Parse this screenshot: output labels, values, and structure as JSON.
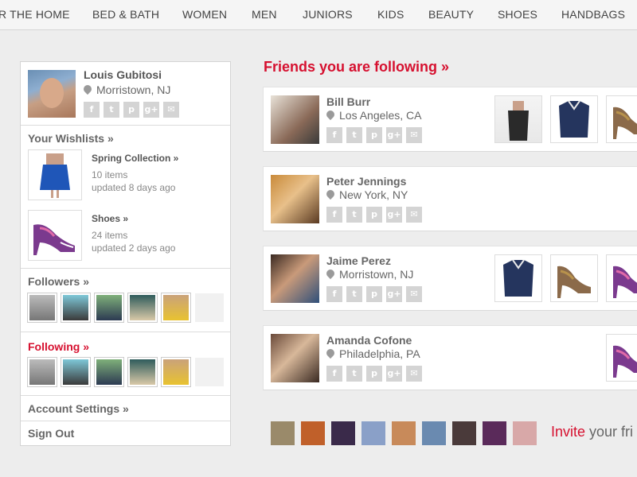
{
  "nav": {
    "items": [
      "R THE HOME",
      "BED & BATH",
      "WOMEN",
      "MEN",
      "JUNIORS",
      "KIDS",
      "BEAUTY",
      "SHOES",
      "HANDBAGS"
    ]
  },
  "profile": {
    "name": "Louis Gubitosi",
    "location": "Morristown, NJ"
  },
  "social_icons": [
    "f",
    "t",
    "p",
    "g+",
    "✉"
  ],
  "wishlists": {
    "title": "Your Wishlists »",
    "items": [
      {
        "name": "Spring Collection »",
        "count": "10 items",
        "updated": "updated 8 days ago"
      },
      {
        "name": "Shoes »",
        "count": "24 items",
        "updated": "updated 2 days ago"
      }
    ]
  },
  "followers": {
    "title": "Followers »"
  },
  "following": {
    "title": "Following »"
  },
  "menu": {
    "account_settings": "Account Settings »",
    "sign_out": "Sign Out"
  },
  "main": {
    "title": "Friends you are following »",
    "friends": [
      {
        "name": "Bill Burr",
        "location": "Los Angeles, CA"
      },
      {
        "name": "Peter Jennings",
        "location": "New York, NY"
      },
      {
        "name": "Jaime Perez",
        "location": "Morristown, NJ"
      },
      {
        "name": "Amanda Cofone",
        "location": "Philadelphia, PA"
      }
    ]
  },
  "invite": {
    "highlight": "Invite",
    "rest": " your fri"
  },
  "colors": {
    "accent": "#d6102f",
    "background": "#ededed",
    "icon_gray": "#d4d4d4"
  }
}
